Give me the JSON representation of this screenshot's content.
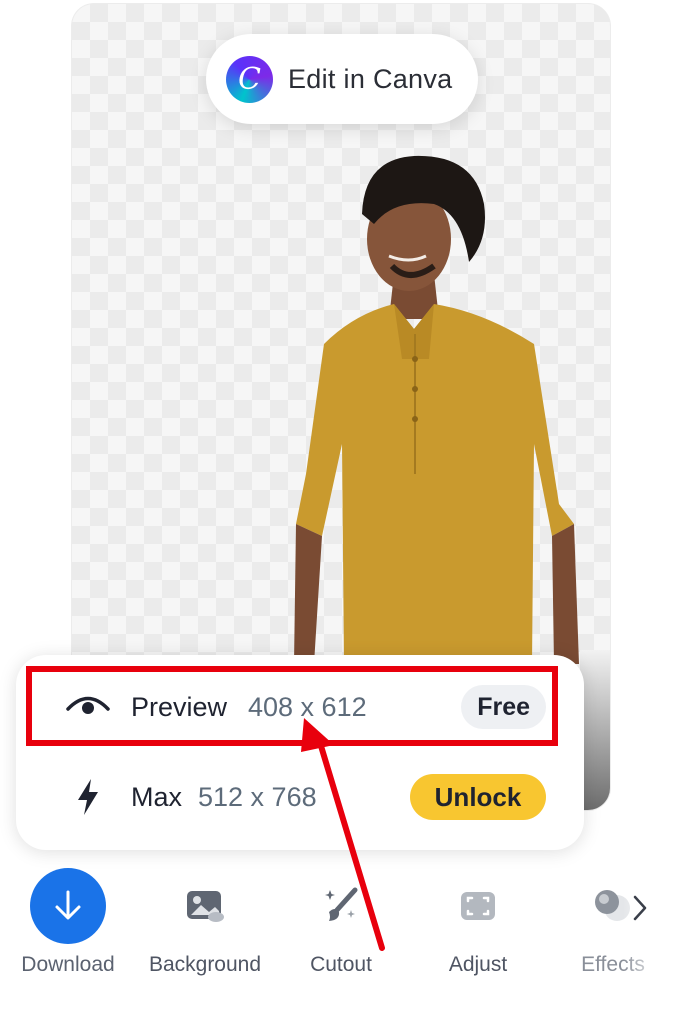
{
  "edit_button": {
    "label": "Edit in Canva",
    "logo_letter": "C"
  },
  "panel": {
    "preview": {
      "name": "Preview",
      "dims": "408 x 612",
      "badge": "Free"
    },
    "max": {
      "name": "Max",
      "dims": "512 x 768",
      "button": "Unlock"
    }
  },
  "toolbar": {
    "items": [
      {
        "label": "Download",
        "icon": "download-arrow-icon"
      },
      {
        "label": "Background",
        "icon": "image-icon"
      },
      {
        "label": "Cutout",
        "icon": "magic-brush-icon"
      },
      {
        "label": "Adjust",
        "icon": "adjust-frame-icon"
      },
      {
        "label": "Effects",
        "icon": "effects-circles-icon"
      }
    ],
    "next_icon": "chevron-right-icon"
  },
  "colors": {
    "highlight": "#e8000d",
    "download_blue": "#1a73e8",
    "unlock_yellow": "#f8c630",
    "shirt": "#c99a2e"
  }
}
